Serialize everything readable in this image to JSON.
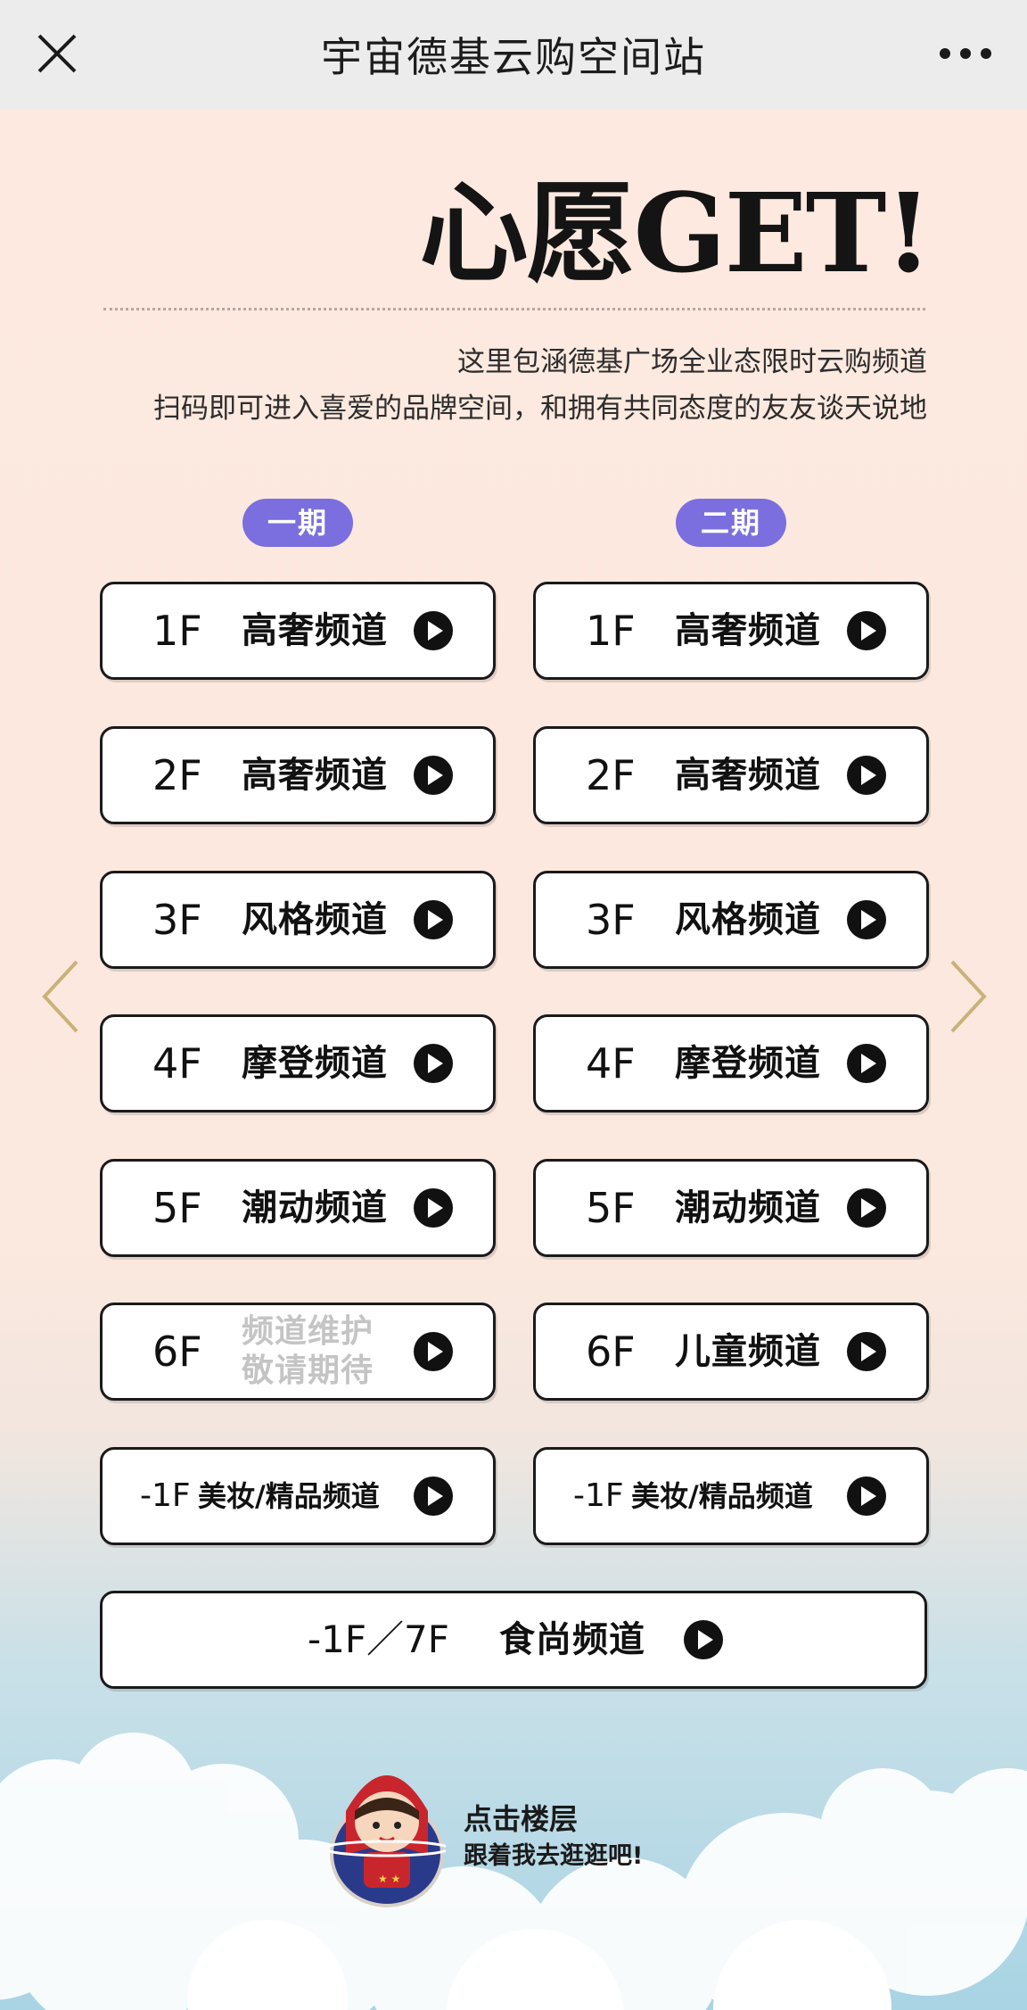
{
  "topbar": {
    "title": "宇宙德基云购空间站",
    "close_icon": "close-icon",
    "more_icon": "more-dots-icon"
  },
  "hero": {
    "headline": "心愿GET!",
    "desc_line1": "这里包涵德基广场全业态限时云购频道",
    "desc_line2": "扫码即可进入喜爱的品牌空间，和拥有共同态度的友友谈天说地"
  },
  "phases": {
    "phase1": "一期",
    "phase2": "二期"
  },
  "phase1_channels": [
    {
      "floor": "1F",
      "label": "高奢频道"
    },
    {
      "floor": "2F",
      "label": "高奢频道"
    },
    {
      "floor": "3F",
      "label": "风格频道"
    },
    {
      "floor": "4F",
      "label": "摩登频道"
    },
    {
      "floor": "5F",
      "label": "潮动频道"
    },
    {
      "floor": "6F",
      "label": "频道维护",
      "label2": "敬请期待"
    },
    {
      "floor": "-1F",
      "label": "美妆/精品频道"
    }
  ],
  "phase2_channels": [
    {
      "floor": "1F",
      "label": "高奢频道"
    },
    {
      "floor": "2F",
      "label": "高奢频道"
    },
    {
      "floor": "3F",
      "label": "风格频道"
    },
    {
      "floor": "4F",
      "label": "摩登频道"
    },
    {
      "floor": "5F",
      "label": "潮动频道"
    },
    {
      "floor": "6F",
      "label": "儿童频道"
    },
    {
      "floor": "-1F",
      "label": "美妆/精品频道"
    }
  ],
  "food_channel": {
    "floor": "-1F／7F",
    "label": "食尚频道"
  },
  "footer": {
    "line1": "点击楼层",
    "line2": "跟着我去逛逛吧!"
  },
  "colors": {
    "accent": "#7b6fdf",
    "arrow": "#c9b27a",
    "background_top": "#fde9df",
    "background_bottom": "#a9d4e4"
  },
  "icons": {
    "play": "play-circle-icon",
    "prev": "chevron-left-icon",
    "next": "chevron-right-icon",
    "mascot": "mascot-illustration"
  }
}
